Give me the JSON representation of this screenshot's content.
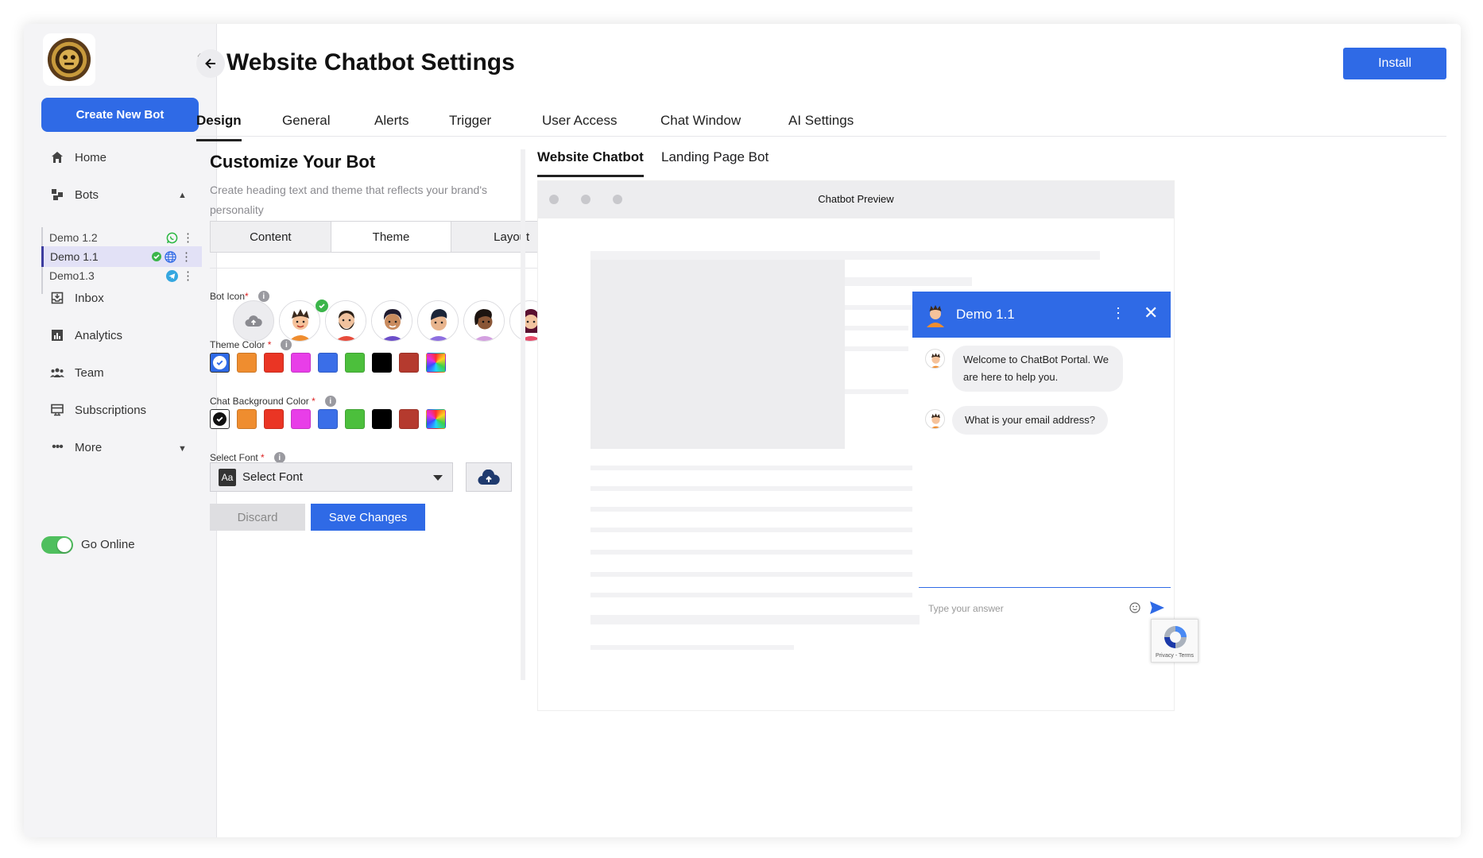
{
  "sidebar": {
    "create_label": "Create New Bot",
    "nav": {
      "home": "Home",
      "bots": "Bots",
      "inbox": "Inbox",
      "analytics": "Analytics",
      "team": "Team",
      "subscriptions": "Subscriptions",
      "more": "More"
    },
    "bots": [
      {
        "name": "Demo 1.2",
        "channel": "whatsapp-icon"
      },
      {
        "name": "Demo 1.1",
        "channel": "globe-icon",
        "verified": true
      },
      {
        "name": "Demo1.3",
        "channel": "telegram-icon"
      }
    ],
    "go_online": "Go Online"
  },
  "header": {
    "title": "Website Chatbot Settings",
    "install_label": "Install",
    "tabs": [
      "Design",
      "General",
      "Alerts",
      "Trigger",
      "User Access",
      "Chat Window",
      "AI Settings"
    ],
    "active_tab": "Design"
  },
  "customize": {
    "title": "Customize Your Bot",
    "subtitle": "Create heading text and theme that reflects your brand's personality",
    "segments": [
      "Content",
      "Theme",
      "Layout"
    ],
    "active_segment": "Theme",
    "bot_icon_label": "Bot Icon",
    "theme_color_label": "Theme Color",
    "chat_bg_label": "Chat Background Color",
    "select_font_label": "Select Font",
    "font_value": "Select Font",
    "font_badge": "Aa",
    "discard_label": "Discard",
    "save_label": "Save Changes",
    "colors": [
      "#2f6ae6",
      "#ef8d2f",
      "#ea3524",
      "#e83ee8",
      "#3a6ee8",
      "#4cbf3c",
      "#000000",
      "#b53a2e",
      "gradient"
    ],
    "selected_theme_color": "#2f6ae6",
    "selected_bg_color": "#ffffff"
  },
  "preview": {
    "tabs": [
      "Website Chatbot",
      "Landing Page Bot"
    ],
    "active_tab": "Website Chatbot",
    "bar_title": "Chatbot Preview",
    "chat": {
      "bot_name": "Demo 1.1",
      "messages": [
        "Welcome to ChatBot Portal. We are here to help you.",
        "What is your email address?"
      ],
      "input_placeholder": "Type your answer"
    },
    "recaptcha_text": "Privacy - Terms"
  }
}
